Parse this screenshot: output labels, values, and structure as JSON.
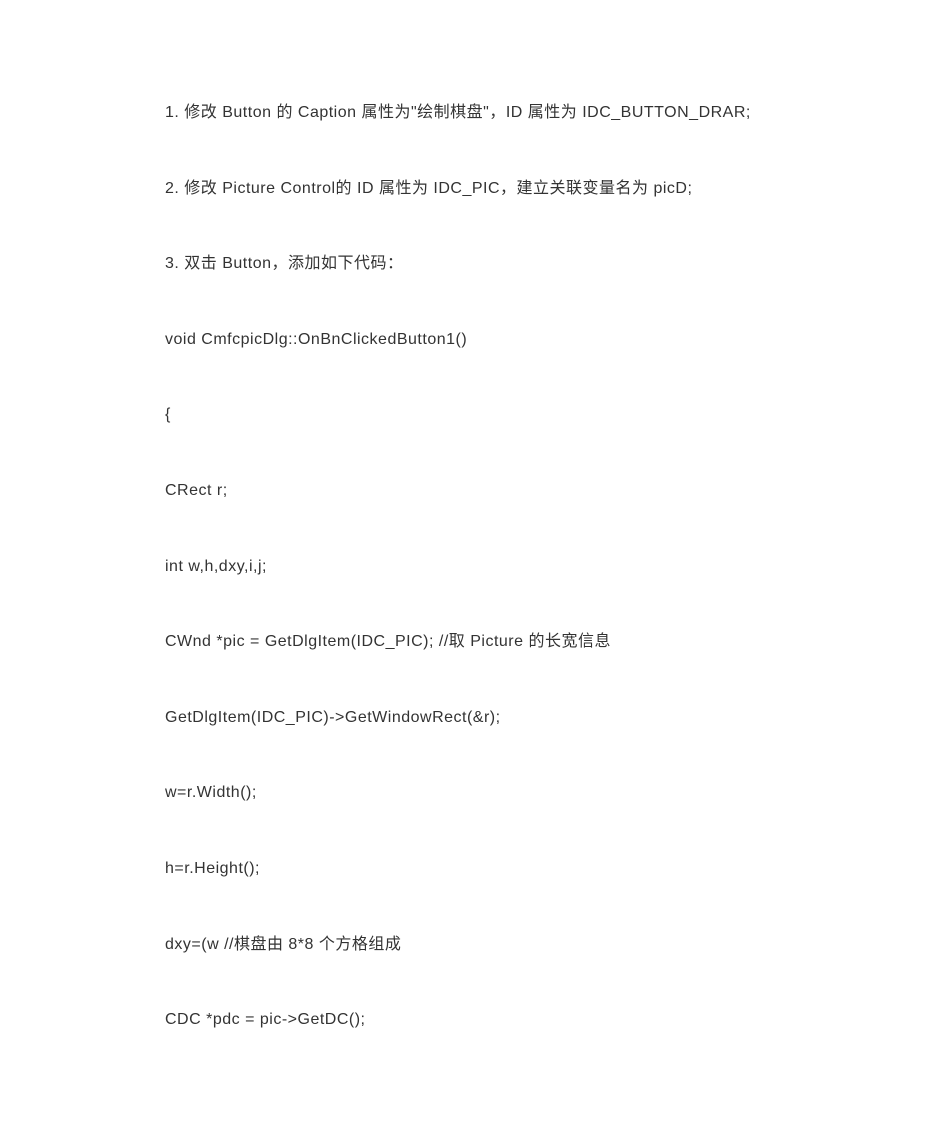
{
  "document": {
    "lines": [
      "1. 修改 Button 的 Caption 属性为\"绘制棋盘\"，ID 属性为 IDC_BUTTON_DRAR;",
      "2. 修改 Picture  Control的 ID 属性为 IDC_PIC，建立关联变量名为 picD;",
      "3. 双击 Button，添加如下代码：",
      "void  CmfcpicDlg::OnBnClickedButton1()",
      "{",
      "CRect  r;",
      "int  w,h,dxy,i,j;",
      "CWnd  *pic  =  GetDlgItem(IDC_PIC);    //取 Picture 的长宽信息",
      "GetDlgItem(IDC_PIC)->GetWindowRect(&r);",
      "w=r.Width();",
      "h=r.Height();",
      "dxy=(w                                             //棋盘由 8*8 个方格组成",
      "CDC  *pdc  =  pic->GetDC();"
    ]
  }
}
